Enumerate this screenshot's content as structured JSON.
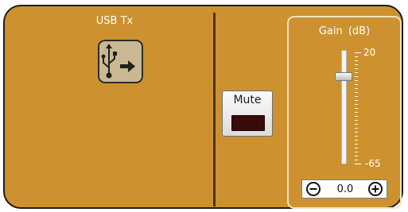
{
  "source": {
    "label": "USB Tx",
    "icon": "usb-transmit-icon"
  },
  "mute": {
    "label": "Mute",
    "active": false,
    "led_color": "#3a0b0b"
  },
  "gain": {
    "title": "Gain  (dB)",
    "max": "20",
    "min": "-65",
    "value": "0.0",
    "max_db": 20,
    "min_db": -65,
    "current_db": 0
  },
  "colors": {
    "panel": "#cd922f",
    "border": "#1c1c1c",
    "divider": "#4c3510",
    "gain_border": "#f4e3bf"
  }
}
